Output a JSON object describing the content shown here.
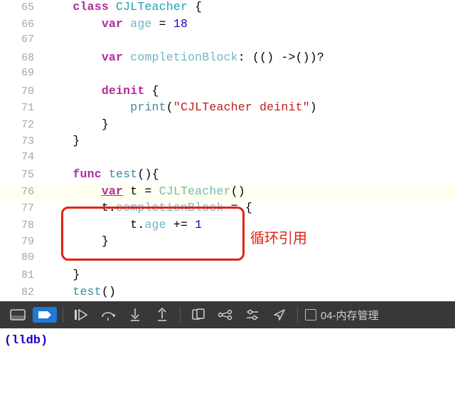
{
  "lines": [
    {
      "n": "65",
      "tokens": [
        [
          "plain",
          "    "
        ],
        [
          "kw",
          "class"
        ],
        [
          "plain",
          " "
        ],
        [
          "typ",
          "CJLTeacher"
        ],
        [
          "plain",
          " {"
        ]
      ]
    },
    {
      "n": "66",
      "tokens": [
        [
          "plain",
          "        "
        ],
        [
          "kw",
          "var"
        ],
        [
          "plain",
          " "
        ],
        [
          "ftyp",
          "age"
        ],
        [
          "plain",
          " = "
        ],
        [
          "num",
          "18"
        ]
      ]
    },
    {
      "n": "67",
      "tokens": []
    },
    {
      "n": "68",
      "tokens": [
        [
          "plain",
          "        "
        ],
        [
          "kw",
          "var"
        ],
        [
          "plain",
          " "
        ],
        [
          "ftyp",
          "completionBlock"
        ],
        [
          "plain",
          ": (() ->())?"
        ]
      ]
    },
    {
      "n": "69",
      "tokens": []
    },
    {
      "n": "70",
      "tokens": [
        [
          "plain",
          "        "
        ],
        [
          "kw",
          "deinit"
        ],
        [
          "plain",
          " {"
        ]
      ]
    },
    {
      "n": "71",
      "tokens": [
        [
          "plain",
          "            "
        ],
        [
          "fn",
          "print"
        ],
        [
          "plain",
          "("
        ],
        [
          "str",
          "\"CJLTeacher deinit\""
        ],
        [
          "plain",
          ")"
        ]
      ]
    },
    {
      "n": "72",
      "tokens": [
        [
          "plain",
          "        }"
        ]
      ]
    },
    {
      "n": "73",
      "tokens": [
        [
          "plain",
          "    }"
        ]
      ]
    },
    {
      "n": "74",
      "tokens": []
    },
    {
      "n": "75",
      "tokens": [
        [
          "plain",
          "    "
        ],
        [
          "kw",
          "func"
        ],
        [
          "plain",
          " "
        ],
        [
          "fn",
          "test"
        ],
        [
          "plain",
          "(){"
        ]
      ]
    },
    {
      "n": "76",
      "hl": true,
      "tokens": [
        [
          "plain",
          "        "
        ],
        [
          "kw idu",
          "var"
        ],
        [
          "plain",
          " t = "
        ],
        [
          "ftyp",
          "CJLTeacher"
        ],
        [
          "plain",
          "()"
        ]
      ]
    },
    {
      "n": "77",
      "tokens": [
        [
          "plain",
          "        t."
        ],
        [
          "ftyp",
          "completionBlock"
        ],
        [
          "plain",
          " = {"
        ]
      ]
    },
    {
      "n": "78",
      "tokens": [
        [
          "plain",
          "            t."
        ],
        [
          "ftyp",
          "age"
        ],
        [
          "plain",
          " += "
        ],
        [
          "num",
          "1"
        ]
      ]
    },
    {
      "n": "79",
      "tokens": [
        [
          "plain",
          "        }"
        ]
      ]
    },
    {
      "n": "80",
      "tokens": []
    },
    {
      "n": "81",
      "tokens": [
        [
          "plain",
          "    }"
        ]
      ]
    },
    {
      "n": "82",
      "tokens": [
        [
          "plain",
          "    "
        ],
        [
          "fn",
          "test"
        ],
        [
          "plain",
          "()"
        ]
      ]
    }
  ],
  "annotation": {
    "label": "循环引用"
  },
  "toolbar": {
    "target": "04-内存管理"
  },
  "console": {
    "prompt": "(lldb)"
  },
  "colors": {
    "highlight": "#e02313",
    "breakpoint": "#1b7bd6"
  }
}
